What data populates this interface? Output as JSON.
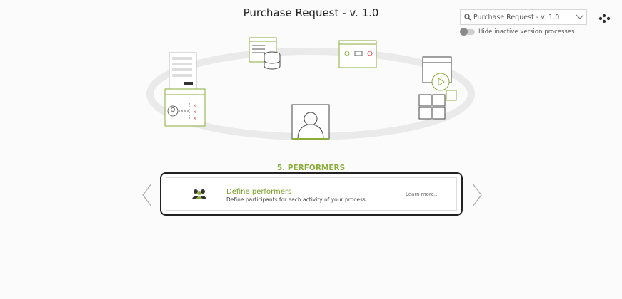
{
  "header": {
    "title": "Purchase Request - v. 1.0"
  },
  "version_selector": {
    "value": "Purchase Request - v. 1.0",
    "icon": "search-icon"
  },
  "hide_inactive": {
    "label": "Hide inactive version processes",
    "enabled": false
  },
  "menu": {
    "icon": "dots-menu-icon"
  },
  "step": {
    "title": "5. PERFORMERS",
    "card": {
      "heading": "Define performers",
      "description": "Define participants for each activity of your process.",
      "link": "Learn more..."
    }
  },
  "colors": {
    "accent": "#8bae3a",
    "text": "#333333",
    "border": "#222222"
  }
}
